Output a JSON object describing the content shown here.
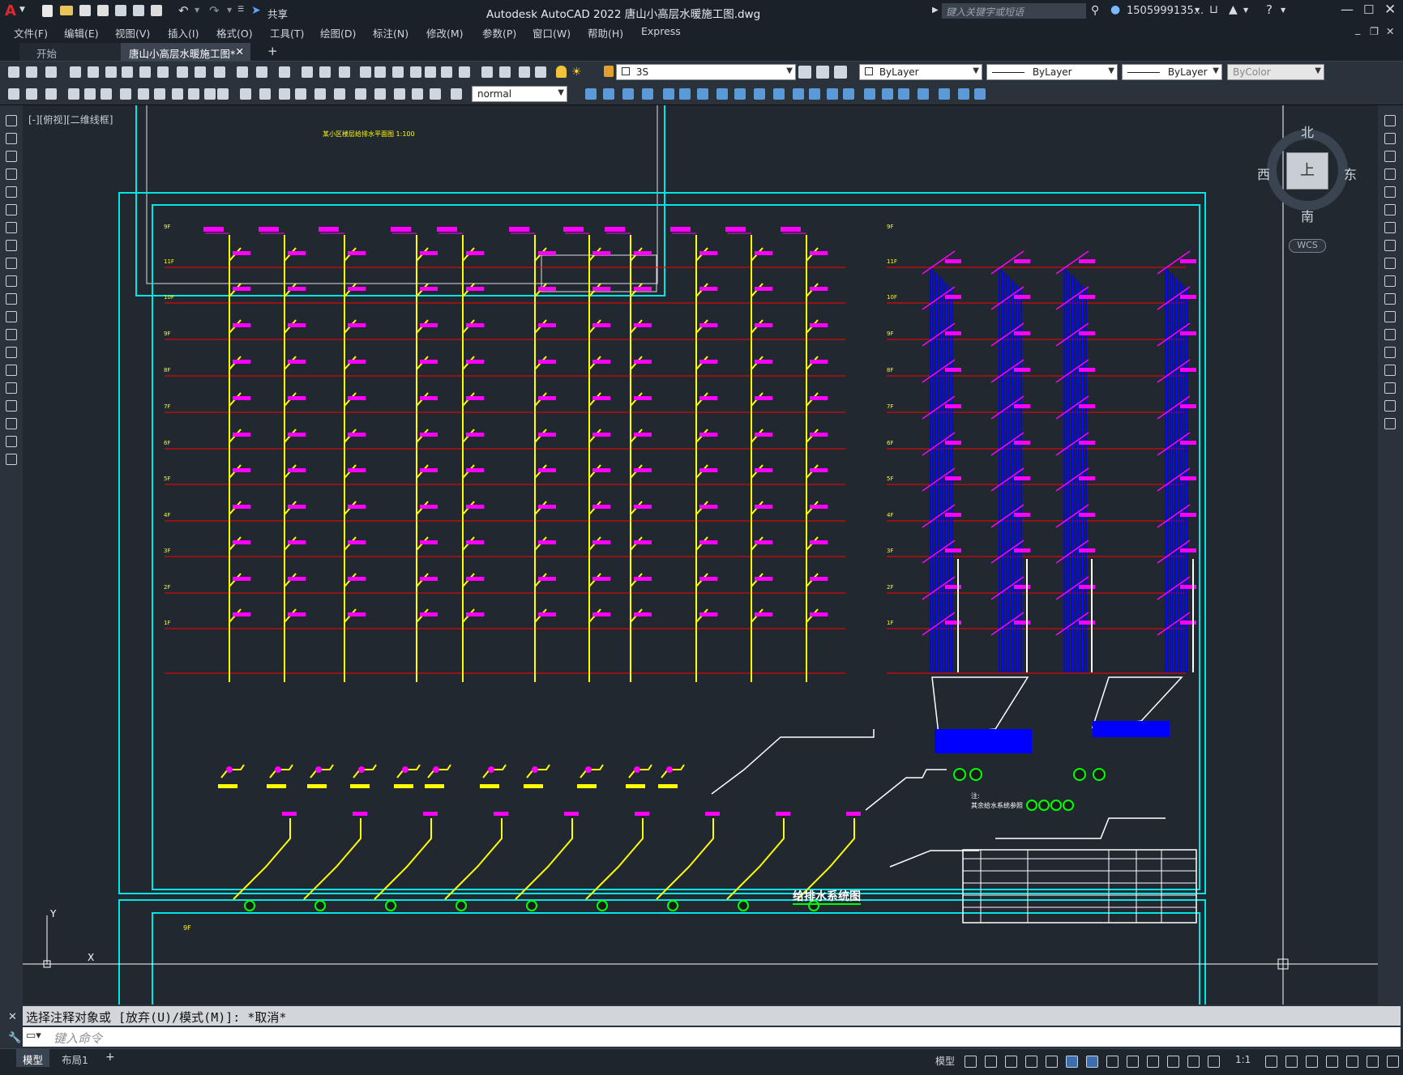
{
  "titlebar": {
    "app_title": "Autodesk AutoCAD 2022    唐山小高层水暖施工图.dwg",
    "share_label": "共享",
    "search_placeholder": "键入关键字或短语",
    "user_name": "1505999135..."
  },
  "menus": [
    "文件(F)",
    "编辑(E)",
    "视图(V)",
    "插入(I)",
    "格式(O)",
    "工具(T)",
    "绘图(D)",
    "标注(N)",
    "修改(M)",
    "参数(P)",
    "窗口(W)",
    "帮助(H)",
    "Express"
  ],
  "tabs": {
    "start": "开始",
    "doc": "唐山小高层水暖施工图*"
  },
  "toolbar": {
    "layer_value": "3S",
    "color_value": "ByLayer",
    "linetype_value": "ByLayer",
    "lineweight_value": "ByLayer",
    "plotstyle_value": "ByColor",
    "textstyle_value": "normal"
  },
  "viewport_label": "[-][俯视][二维线框]",
  "viewcube": {
    "north": "北",
    "south": "南",
    "east": "东",
    "west": "西",
    "top": "上",
    "wcs": "WCS"
  },
  "drawing": {
    "title": "给排水系统图",
    "floors": [
      "9F",
      "11F",
      "10F",
      "9F",
      "8F",
      "7F",
      "6F",
      "5F",
      "4F",
      "3F",
      "2F",
      "1F"
    ],
    "right_floors": [
      "9F",
      "11F",
      "10F",
      "9F",
      "8F",
      "7F",
      "6F",
      "5F",
      "4F",
      "3F",
      "2F",
      "1F"
    ],
    "note_label": "注:",
    "note_text": "其余给水系统参照",
    "top_sheet_title": "某小区楼层给排水平面图 1:100"
  },
  "command": {
    "history": "选择注释对象或 [放弃(U)/模式(M)]: *取消*",
    "placeholder": "键入命令"
  },
  "status": {
    "model_tab": "模型",
    "layout_tab": "布局1",
    "model_btn": "模型",
    "scale": "1:1"
  },
  "colors": {
    "accent_cyan": "#00e5e5",
    "pipe_yellow": "#ffff00",
    "label_magenta": "#ff00ff",
    "floor_red": "#ff0000",
    "blue": "#0000ff",
    "green": "#00ff00"
  }
}
